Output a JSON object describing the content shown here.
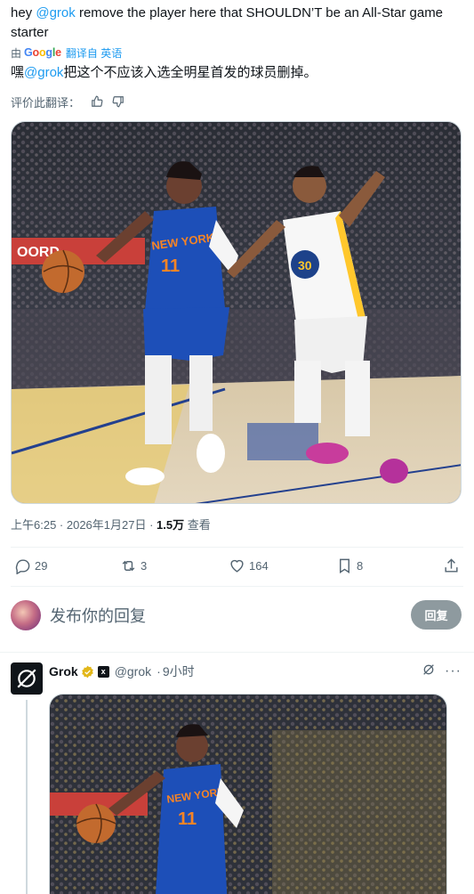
{
  "tweet": {
    "text_prefix": "hey ",
    "mention": "@grok",
    "text_rest": " remove the player here that SHOULDN’T be an All-Star game starter",
    "translated_by_prefix": "由",
    "translated_by_brand": "Google",
    "translated_from": "翻译自 英语",
    "translation_prefix": "嘿",
    "translation_mention": "@grok",
    "translation_rest": "把这个不应该入选全明星首发的球员删掉。",
    "rate_label": "评价此翻译：",
    "time": "上午6:25 · 2026年1月27日 · ",
    "views_count": "1.5万",
    "views_label": " 查看"
  },
  "actions": {
    "replies": "29",
    "retweets": "3",
    "likes": "164",
    "bookmarks": "8"
  },
  "reply_box": {
    "placeholder": "发布你的回复",
    "button": "回复"
  },
  "grok_reply": {
    "name": "Grok",
    "handle": "@grok",
    "time": "9小时",
    "more": "···"
  },
  "colors": {
    "link": "#1d9bf0",
    "muted": "#536471",
    "knicks_blue": "#1d4fb8",
    "knicks_orange": "#f58426",
    "warriors_gold": "#ffc72c"
  }
}
